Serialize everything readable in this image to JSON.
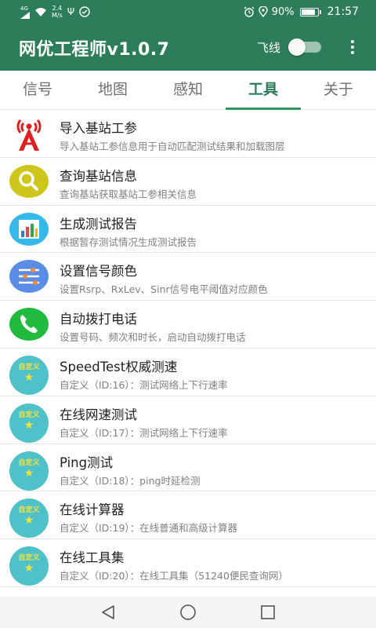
{
  "status_bar": {
    "network": "4G",
    "speed_value": "2.4",
    "speed_unit": "M/s",
    "usb_glyph": "Ψ",
    "battery_percent": "90%",
    "battery_level": 0.9,
    "time": "21:57",
    "icons": [
      "signal-icon",
      "wifi-icon",
      "usb-icon",
      "app-notification-icon",
      "alarm-icon",
      "location-icon",
      "battery-icon"
    ]
  },
  "app_bar": {
    "title": "网优工程师v1.0.7",
    "airplane_label": "飞线",
    "airplane_on": false,
    "menu_icon": "more-vert-icon"
  },
  "tabs": [
    {
      "label": "信号",
      "active": false
    },
    {
      "label": "地图",
      "active": false
    },
    {
      "label": "感知",
      "active": false
    },
    {
      "label": "工具",
      "active": true
    },
    {
      "label": "关于",
      "active": false
    }
  ],
  "items": [
    {
      "title": "导入基站工参",
      "desc": "导入基站工参信息用于自动匹配测试结果和加载图层",
      "icon": "cell-tower-icon"
    },
    {
      "title": "查询基站信息",
      "desc": "查询基站获取基站工参相关信息",
      "icon": "search-icon"
    },
    {
      "title": "生成测试报告",
      "desc": "根据暂存测试情况生成测试报告",
      "icon": "bar-chart-icon"
    },
    {
      "title": "设置信号颜色",
      "desc": "设置Rsrp、RxLev、Sinr信号电平阈值对应颜色",
      "icon": "sliders-icon"
    },
    {
      "title": "自动拨打电话",
      "desc": "设置号码、频次和时长，启动自动拨打电话",
      "icon": "phone-icon"
    },
    {
      "title": "SpeedTest权威测速",
      "desc": "自定义（ID:16）：测试网络上下行速率",
      "icon": "custom-star-icon"
    },
    {
      "title": "在线网速测试",
      "desc": "自定义（ID:17）：测试网络上下行速率",
      "icon": "custom-star-icon"
    },
    {
      "title": "Ping测试",
      "desc": "自定义（ID:18）：ping时延检测",
      "icon": "custom-star-icon"
    },
    {
      "title": "在线计算器",
      "desc": "自定义（ID:19）：在线普通和高级计算器",
      "icon": "custom-star-icon"
    },
    {
      "title": "在线工具集",
      "desc": "自定义（ID:20）：在线工具集（51240便民查询网）",
      "icon": "custom-star-icon"
    }
  ],
  "custom_icon_text": "自定义",
  "custom_icon_star": "★",
  "nav_bar": {
    "buttons": [
      "back-triangle-icon",
      "home-circle-icon",
      "recents-square-icon"
    ]
  },
  "colors": {
    "primary": "#2e7d5a",
    "accent": "#2e9a5e",
    "custom_icon_bg": "#4fc1c9",
    "custom_icon_fg": "#f4e23b"
  }
}
